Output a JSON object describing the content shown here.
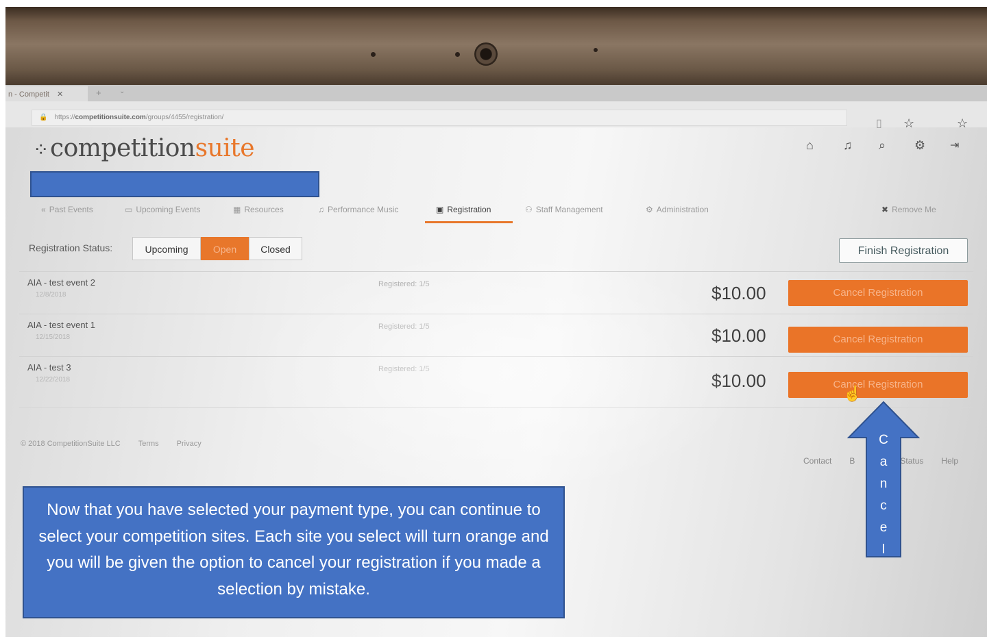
{
  "browser": {
    "tab_title": "n - Competit",
    "tab_close": "✕",
    "tab_new": "+",
    "tab_dropdown": "⌄",
    "url_scheme": "https://",
    "url_domain": "competitionsuite.com",
    "url_path": "/groups/4455/registration/"
  },
  "app": {
    "logo_dots": "⁘",
    "logo_main": "competition",
    "logo_accent": "suite"
  },
  "nav": {
    "items": [
      {
        "icon": "«",
        "label": "Past Events"
      },
      {
        "icon": "▭",
        "label": "Upcoming Events"
      },
      {
        "icon": "▦",
        "label": "Resources"
      },
      {
        "icon": "♫",
        "label": "Performance Music"
      },
      {
        "icon": "▣",
        "label": "Registration"
      },
      {
        "icon": "⚇",
        "label": "Staff Management"
      },
      {
        "icon": "⚙",
        "label": "Administration"
      }
    ],
    "remove_me": "Remove Me"
  },
  "registration": {
    "status_label": "Registration Status:",
    "options": [
      "Upcoming",
      "Open",
      "Closed"
    ],
    "selected": "Open",
    "finish_button": "Finish Registration"
  },
  "events": [
    {
      "name": "AIA - test event 2",
      "date": "12/8/2018",
      "registered": "Registered: 1/5",
      "price": "$10.00",
      "action": "Cancel Registration"
    },
    {
      "name": "AIA - test event 1",
      "date": "12/15/2018",
      "registered": "Registered: 1/5",
      "price": "$10.00",
      "action": "Cancel Registration"
    },
    {
      "name": "AIA - test 3",
      "date": "12/22/2018",
      "registered": "Registered: 1/5",
      "price": "$10.00",
      "action": "Cancel Registration"
    }
  ],
  "footer": {
    "copyright": "© 2018 CompetitionSuite LLC",
    "terms": "Terms",
    "privacy": "Privacy",
    "contact": "Contact",
    "b": "B",
    "status": "Status",
    "help": "Help"
  },
  "annotation": {
    "callout_text": "Now that you have selected your payment type, you can continue to select your competition sites.  Each site you select will turn orange and you will be given the option to cancel your registration if you made a selection by mistake.",
    "arrow_text": "C\na\nn\nc\ne\nl",
    "color": "#4472c4"
  },
  "colors": {
    "accent": "#e8772b",
    "annotation": "#4472c4"
  }
}
